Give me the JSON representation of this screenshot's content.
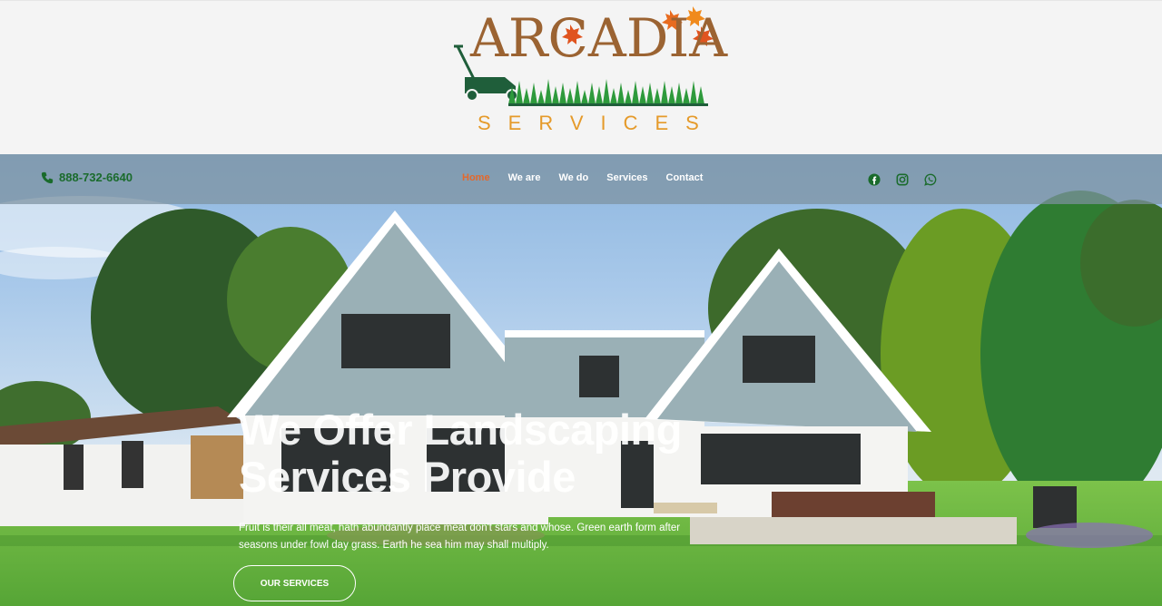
{
  "logo": {
    "title": "ARCADIA",
    "subtitle": "SERVICES"
  },
  "header": {
    "phone": "888-732-6640",
    "phone_icon": "phone-icon",
    "nav": [
      {
        "label": "Home",
        "active": true
      },
      {
        "label": "We are",
        "active": false
      },
      {
        "label": "We do",
        "active": false
      },
      {
        "label": "Services",
        "active": false
      },
      {
        "label": "Contact",
        "active": false
      }
    ],
    "social_icons": [
      "facebook-icon",
      "instagram-icon",
      "whatsapp-icon"
    ]
  },
  "hero": {
    "title": "We Offer Landscaping Services Provide",
    "text": "Fruit is their all meat, hath abundantly place meat don't stars and whose. Green earth form after seasons under fowl day grass. Earth he sea him may shall multiply.",
    "cta": "OUR SERVICES"
  },
  "colors": {
    "brand_green": "#1a6b2c",
    "accent_orange": "#e4682b",
    "logo_brown": "#9b6332",
    "logo_orange": "#e59a2a",
    "nav_overlay": "#7d91a0"
  }
}
